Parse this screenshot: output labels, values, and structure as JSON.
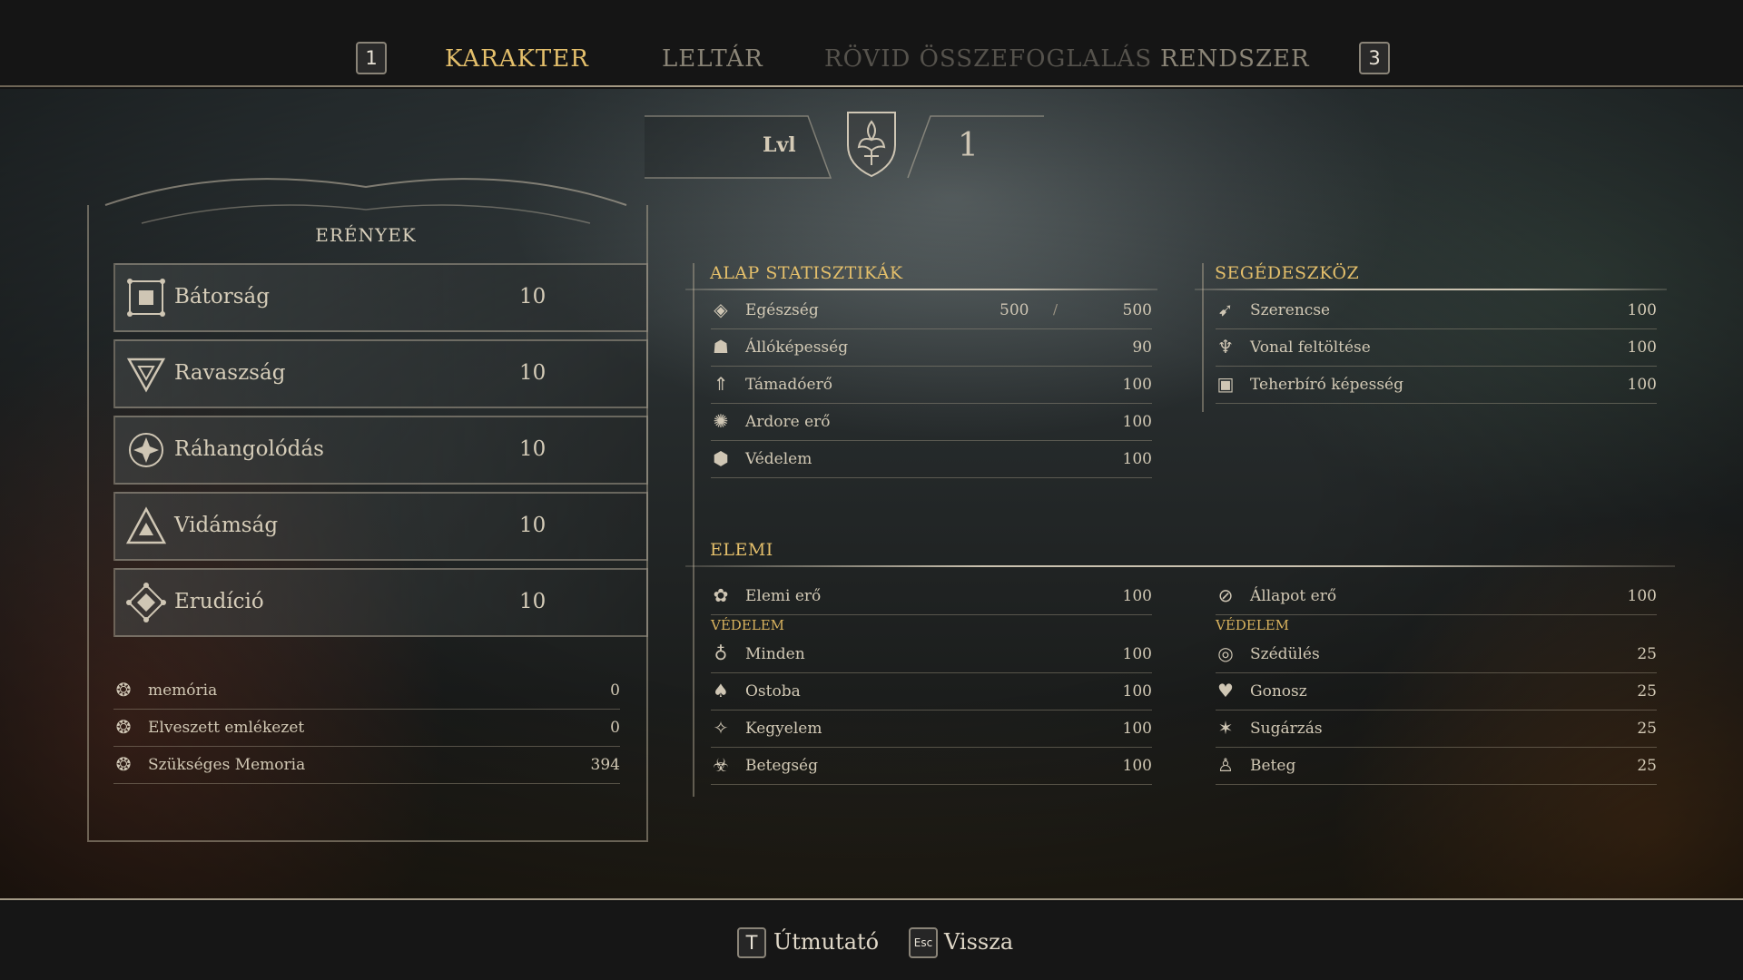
{
  "nav": {
    "left_key": "1",
    "right_key": "3",
    "tabs": [
      {
        "label": "KARAKTER",
        "state": "active"
      },
      {
        "label": "LELTÁR",
        "state": "normal"
      },
      {
        "label": "RÖVID ÖSSZEFOGLALÁS",
        "state": "disabled"
      },
      {
        "label": "RENDSZER",
        "state": "normal"
      }
    ]
  },
  "level": {
    "label": "Lvl",
    "value": "1",
    "crest_icon": "fleur-de-lis-crest-icon"
  },
  "virtues": {
    "title": "ERÉNYEK",
    "items": [
      {
        "name": "Bátorság",
        "value": "10",
        "icon": "square-virtue-icon"
      },
      {
        "name": "Ravaszság",
        "value": "10",
        "icon": "triangle-down-virtue-icon"
      },
      {
        "name": "Ráhangolódás",
        "value": "10",
        "icon": "star-virtue-icon"
      },
      {
        "name": "Vidámság",
        "value": "10",
        "icon": "triangle-up-virtue-icon"
      },
      {
        "name": "Erudíció",
        "value": "10",
        "icon": "diamond-virtue-icon"
      }
    ]
  },
  "memory": [
    {
      "name": "memória",
      "value": "0",
      "icon": "memory-icon"
    },
    {
      "name": "Elveszett emlékezet",
      "value": "0",
      "icon": "lost-memory-icon"
    },
    {
      "name": "Szükséges Memoria",
      "value": "394",
      "icon": "required-memory-icon"
    }
  ],
  "base_stats": {
    "title": "ALAP STATISZTIKÁK",
    "health": {
      "name": "Egészség",
      "current": "500",
      "separator": "/",
      "max": "500",
      "icon": "health-icon"
    },
    "items": [
      {
        "name": "Állóképesség",
        "value": "90",
        "icon": "stamina-icon"
      },
      {
        "name": "Támadóerő",
        "value": "100",
        "icon": "attack-icon"
      },
      {
        "name": "Ardore erő",
        "value": "100",
        "icon": "ardore-icon"
      },
      {
        "name": "Védelem",
        "value": "100",
        "icon": "defense-icon"
      }
    ]
  },
  "utility": {
    "title": "SEGÉDESZKÖZ",
    "items": [
      {
        "name": "Szerencse",
        "value": "100",
        "icon": "luck-icon"
      },
      {
        "name": "Vonal feltöltése",
        "value": "100",
        "icon": "line-charge-icon"
      },
      {
        "name": "Teherbíró képesség",
        "value": "100",
        "icon": "weight-capacity-icon"
      }
    ]
  },
  "elemental": {
    "title": "ELEMI",
    "left": {
      "power": {
        "name": "Elemi erő",
        "value": "100",
        "icon": "elemental-power-icon"
      },
      "defense_title": "VÉDELEM",
      "items": [
        {
          "name": "Minden",
          "value": "100",
          "icon": "all-element-icon"
        },
        {
          "name": "Ostoba",
          "value": "100",
          "icon": "fool-icon"
        },
        {
          "name": "Kegyelem",
          "value": "100",
          "icon": "grace-icon"
        },
        {
          "name": "Betegség",
          "value": "100",
          "icon": "disease-icon"
        }
      ]
    },
    "right": {
      "power": {
        "name": "Állapot erő",
        "value": "100",
        "icon": "status-power-icon"
      },
      "defense_title": "VÉDELEM",
      "items": [
        {
          "name": "Szédülés",
          "value": "25",
          "icon": "dizziness-icon"
        },
        {
          "name": "Gonosz",
          "value": "25",
          "icon": "evil-icon"
        },
        {
          "name": "Sugárzás",
          "value": "25",
          "icon": "radiation-icon"
        },
        {
          "name": "Beteg",
          "value": "25",
          "icon": "sick-icon"
        }
      ]
    }
  },
  "footer": {
    "guide_key": "T",
    "guide_label": "Útmutató",
    "back_key": "Esc",
    "back_label": "Vissza"
  }
}
